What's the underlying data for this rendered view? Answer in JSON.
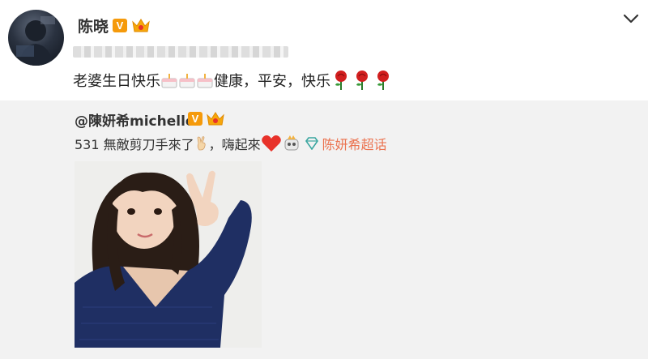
{
  "post": {
    "username": "陈晓",
    "verified_badge": "V",
    "main_text": "老婆生日快乐",
    "main_text_tail_1": "健康，平安，快乐",
    "emojis": [
      "cake-icon",
      "rose-icon"
    ]
  },
  "repost": {
    "author": "@陳妍希michelle",
    "verified_badge": "V",
    "text_part1": "531 無敵剪刀手來了",
    "text_part2": "，嗨起來",
    "topic": "陈妍希超话"
  },
  "colors": {
    "badge_orange": "#f59a0b",
    "repost_bg": "#f2f2f2",
    "topic_link": "#eb7350",
    "heart_red": "#e8322a",
    "rose_red": "#d21f1f"
  }
}
